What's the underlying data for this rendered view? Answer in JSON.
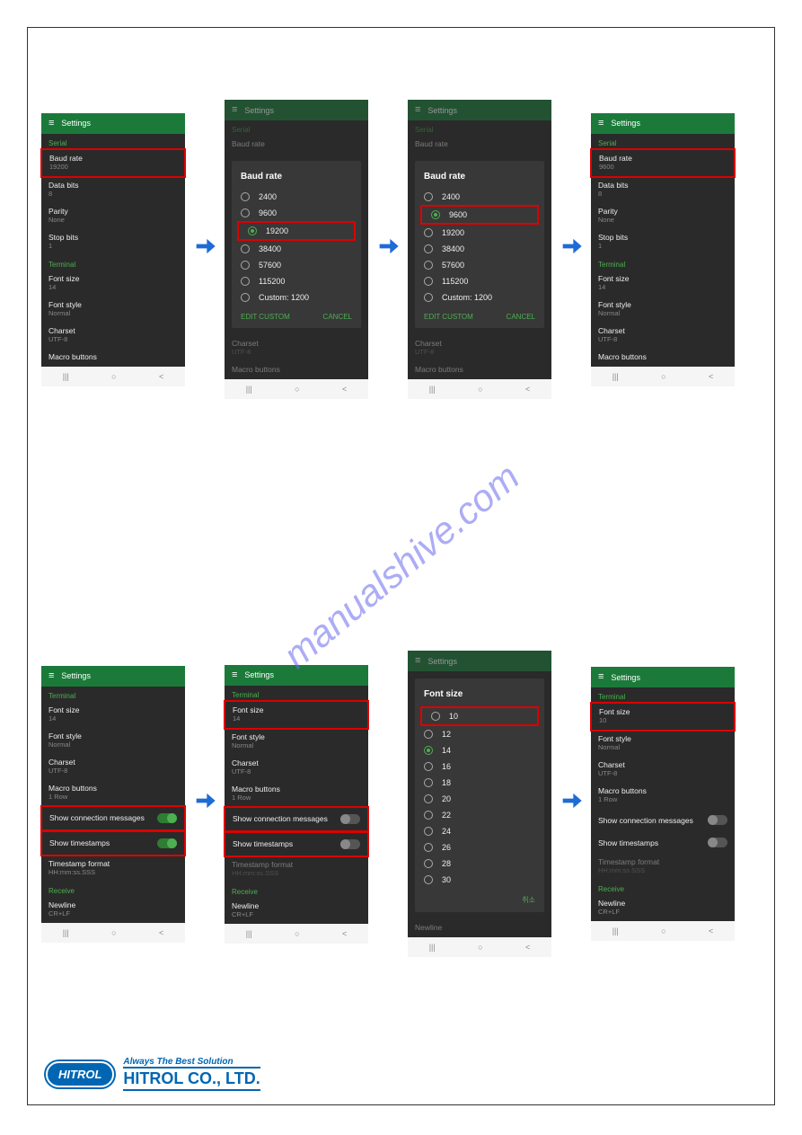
{
  "app_title": "Settings",
  "sections": {
    "serial": "Serial",
    "terminal": "Terminal",
    "receive": "Receive"
  },
  "settings": {
    "baud_rate": {
      "label": "Baud rate",
      "val1": "19200",
      "val4": "9600"
    },
    "data_bits": {
      "label": "Data bits",
      "val": "8"
    },
    "parity": {
      "label": "Parity",
      "val": "None"
    },
    "stop_bits": {
      "label": "Stop bits",
      "val": "1"
    },
    "font_size": {
      "label": "Font size",
      "val": "14",
      "val_after": "10"
    },
    "font_style": {
      "label": "Font style",
      "val": "Normal"
    },
    "charset": {
      "label": "Charset",
      "val": "UTF-8"
    },
    "macro_buttons": {
      "label": "Macro buttons",
      "val": "1 Row"
    },
    "show_conn": "Show connection messages",
    "show_ts": "Show timestamps",
    "ts_format": {
      "label": "Timestamp format",
      "val": "HH:mm:ss.SSS"
    },
    "newline": {
      "label": "Newline",
      "val": "CR+LF"
    }
  },
  "baud_dialog": {
    "title": "Baud rate",
    "options": [
      "2400",
      "9600",
      "19200",
      "38400",
      "57600",
      "115200",
      "Custom: 1200"
    ],
    "edit_custom": "EDIT CUSTOM",
    "cancel": "CANCEL"
  },
  "fontsize_dialog": {
    "title": "Font size",
    "options": [
      "10",
      "12",
      "14",
      "16",
      "18",
      "20",
      "22",
      "24",
      "26",
      "28",
      "30"
    ],
    "cancel": "취소"
  },
  "watermark": "manualshive.com",
  "footer": {
    "logo": "HITROL",
    "tagline": "Always The Best Solution",
    "company": "HITROL CO., LTD."
  }
}
